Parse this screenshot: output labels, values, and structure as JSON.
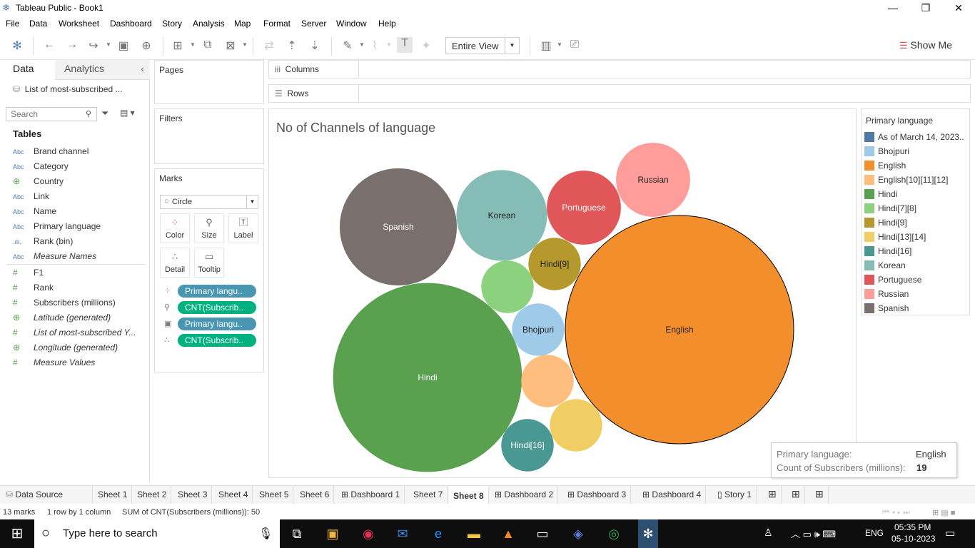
{
  "window": {
    "title": "Tableau Public - Book1",
    "minimize": "—",
    "maximize": "❐",
    "close": "✕"
  },
  "menu": [
    "File",
    "Data",
    "Worksheet",
    "Dashboard",
    "Story",
    "Analysis",
    "Map",
    "Format",
    "Server",
    "Window",
    "Help"
  ],
  "toolbar": {
    "fit_mode": "Entire View",
    "show_me": "Show Me"
  },
  "left_panel": {
    "tabs": {
      "data": "Data",
      "analytics": "Analytics"
    },
    "data_source": "List of most-subscribed ...",
    "search_placeholder": "Search",
    "tables_heading": "Tables",
    "dimension_fields": [
      {
        "type": "Abc",
        "name": "Brand channel"
      },
      {
        "type": "Abc",
        "name": "Category"
      },
      {
        "type": "geo",
        "name": "Country"
      },
      {
        "type": "Abc",
        "name": "Link"
      },
      {
        "type": "Abc",
        "name": "Name"
      },
      {
        "type": "Abc",
        "name": "Primary language"
      },
      {
        "type": "bin",
        "name": "Rank (bin)"
      },
      {
        "type": "Abc",
        "name": "Measure Names",
        "italic": true
      }
    ],
    "measure_fields": [
      {
        "type": "#",
        "name": "F1"
      },
      {
        "type": "#",
        "name": "Rank"
      },
      {
        "type": "#",
        "name": "Subscribers (millions)"
      },
      {
        "type": "geo",
        "name": "Latitude (generated)",
        "italic": true
      },
      {
        "type": "#",
        "name": "List of most-subscribed Y...",
        "italic": true
      },
      {
        "type": "geo",
        "name": "Longitude (generated)",
        "italic": true
      },
      {
        "type": "#",
        "name": "Measure Values",
        "italic": true
      }
    ]
  },
  "cards": {
    "pages": "Pages",
    "filters": "Filters",
    "marks": {
      "title": "Marks",
      "mark_type": "Circle",
      "buttons": {
        "color": "Color",
        "size": "Size",
        "label": "Label",
        "detail": "Detail",
        "tooltip": "Tooltip"
      },
      "pills": [
        {
          "label": "Primary langu..",
          "color": "#4996b2"
        },
        {
          "label": "CNT(Subscrib..",
          "color": "#00b180"
        },
        {
          "label": "Primary langu..",
          "color": "#4996b2"
        },
        {
          "label": "CNT(Subscrib..",
          "color": "#00b180"
        }
      ]
    }
  },
  "shelves": {
    "columns": "Columns",
    "rows": "Rows"
  },
  "chart_data": {
    "type": "packed-bubble",
    "title": "No of Channels of language",
    "measure": "Count of Subscribers (millions)",
    "bubbles": [
      {
        "label": "English",
        "value": 19,
        "color": "#f28e2b"
      },
      {
        "label": "Hindi",
        "value": 13,
        "color": "#59a14f"
      },
      {
        "label": "Spanish",
        "value": 5,
        "color": "#79706e"
      },
      {
        "label": "Korean",
        "value": 3,
        "color": "#86bcb6"
      },
      {
        "label": "Portuguese",
        "value": 2,
        "color": "#e15759"
      },
      {
        "label": "Russian",
        "value": 2,
        "color": "#ff9d9a"
      },
      {
        "label": "Hindi[9]",
        "value": 1,
        "color": "#b6992d"
      },
      {
        "label": "Bhojpuri",
        "value": 1,
        "color": "#a0cbe8"
      },
      {
        "label": "Hindi[7][8]",
        "value": 1,
        "color": "#8cd17d"
      },
      {
        "label": "English[10][11][12]",
        "value": 1,
        "color": "#ffbe7d"
      },
      {
        "label": "Hindi[13][14]",
        "value": 1,
        "color": "#f1ce63"
      },
      {
        "label": "Hindi[16]",
        "value": 1,
        "color": "#499894"
      }
    ]
  },
  "legend": {
    "title": "Primary language",
    "items": [
      {
        "label": "As of March 14, 2023..",
        "color": "#4e79a7"
      },
      {
        "label": "Bhojpuri",
        "color": "#a0cbe8"
      },
      {
        "label": "English",
        "color": "#f28e2b"
      },
      {
        "label": "English[10][11][12]",
        "color": "#ffbe7d"
      },
      {
        "label": "Hindi",
        "color": "#59a14f"
      },
      {
        "label": "Hindi[7][8]",
        "color": "#8cd17d"
      },
      {
        "label": "Hindi[9]",
        "color": "#b6992d"
      },
      {
        "label": "Hindi[13][14]",
        "color": "#f1ce63"
      },
      {
        "label": "Hindi[16]",
        "color": "#499894"
      },
      {
        "label": "Korean",
        "color": "#86bcb6"
      },
      {
        "label": "Portuguese",
        "color": "#e15759"
      },
      {
        "label": "Russian",
        "color": "#ff9d9a"
      },
      {
        "label": "Spanish",
        "color": "#79706e"
      }
    ]
  },
  "tooltip": {
    "k1": "Primary language:",
    "v1": "English",
    "k2": "Count of Subscribers (millions):",
    "v2": "19"
  },
  "sheet_tabs": [
    "Data Source",
    "Sheet 1",
    "Sheet 2",
    "Sheet 3",
    "Sheet 4",
    "Sheet 5",
    "Sheet 6",
    "Dashboard 1",
    "Sheet 7",
    "Sheet 8",
    "Dashboard 2",
    "Dashboard 3",
    "Dashboard 4",
    "Story 1"
  ],
  "active_tab": "Sheet 8",
  "status": {
    "marks": "13 marks",
    "dims": "1 row by 1 column",
    "sum": "SUM of CNT(Subscribers (millions)): 50"
  },
  "taskbar": {
    "search_placeholder": "Type here to search",
    "lang": "ENG",
    "time": "05:35 PM",
    "date": "05-10-2023"
  }
}
